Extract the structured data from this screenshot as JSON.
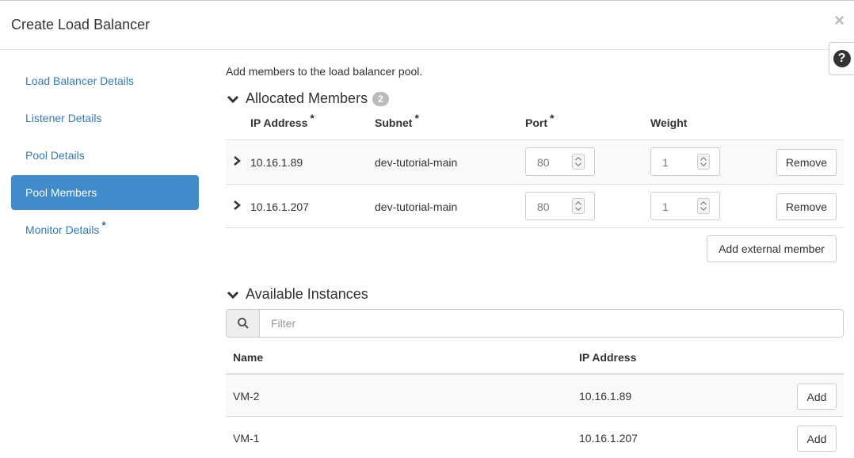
{
  "modal": {
    "title": "Create Load Balancer",
    "close": "×",
    "help": "?"
  },
  "sidebar": {
    "items": [
      {
        "label": "Load Balancer Details",
        "required": ""
      },
      {
        "label": "Listener Details",
        "required": ""
      },
      {
        "label": "Pool Details",
        "required": ""
      },
      {
        "label": "Pool Members",
        "required": ""
      },
      {
        "label": "Monitor Details",
        "required": "*"
      }
    ],
    "active_index": 3
  },
  "main": {
    "intro": "Add members to the load balancer pool.",
    "allocated": {
      "title": "Allocated Members",
      "count": "2",
      "columns": {
        "ip": "IP Address",
        "subnet": "Subnet",
        "port": "Port",
        "weight": "Weight",
        "required": "*"
      },
      "rows": [
        {
          "ip": "10.16.1.89",
          "subnet": "dev-tutorial-main",
          "port": "80",
          "weight": "1",
          "action": "Remove"
        },
        {
          "ip": "10.16.1.207",
          "subnet": "dev-tutorial-main",
          "port": "80",
          "weight": "1",
          "action": "Remove"
        }
      ],
      "add_external": "Add external member"
    },
    "available": {
      "title": "Available Instances",
      "filter_placeholder": "Filter",
      "columns": {
        "name": "Name",
        "ip": "IP Address"
      },
      "rows": [
        {
          "name": "VM-2",
          "ip": "10.16.1.89",
          "action": "Add"
        },
        {
          "name": "VM-1",
          "ip": "10.16.1.207",
          "action": "Add"
        }
      ]
    }
  },
  "colors": {
    "link": "#337ab7",
    "active_bg": "#428bca",
    "badge": "#bbbbbb"
  },
  "icons": {
    "close": "close-icon",
    "help": "question-circle-icon",
    "section": "chevron-down-icon",
    "row": "chevron-right-icon",
    "search": "search-icon",
    "spinner": "spinner-arrows-icon"
  }
}
